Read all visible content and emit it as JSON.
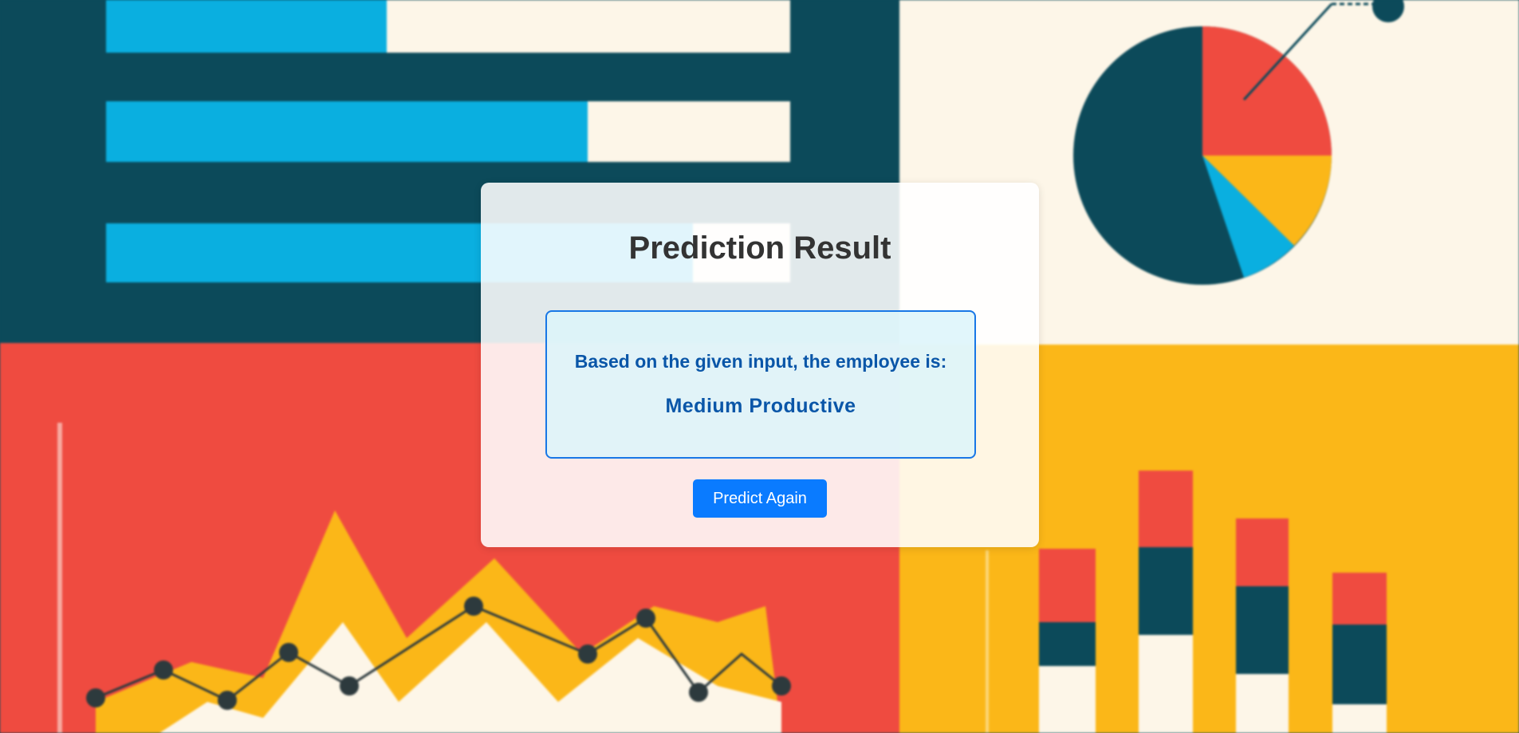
{
  "result": {
    "title": "Prediction Result",
    "prefix": "Based on the given input, the employee is:",
    "value": "Medium Productive",
    "button_label": "Predict Again"
  }
}
